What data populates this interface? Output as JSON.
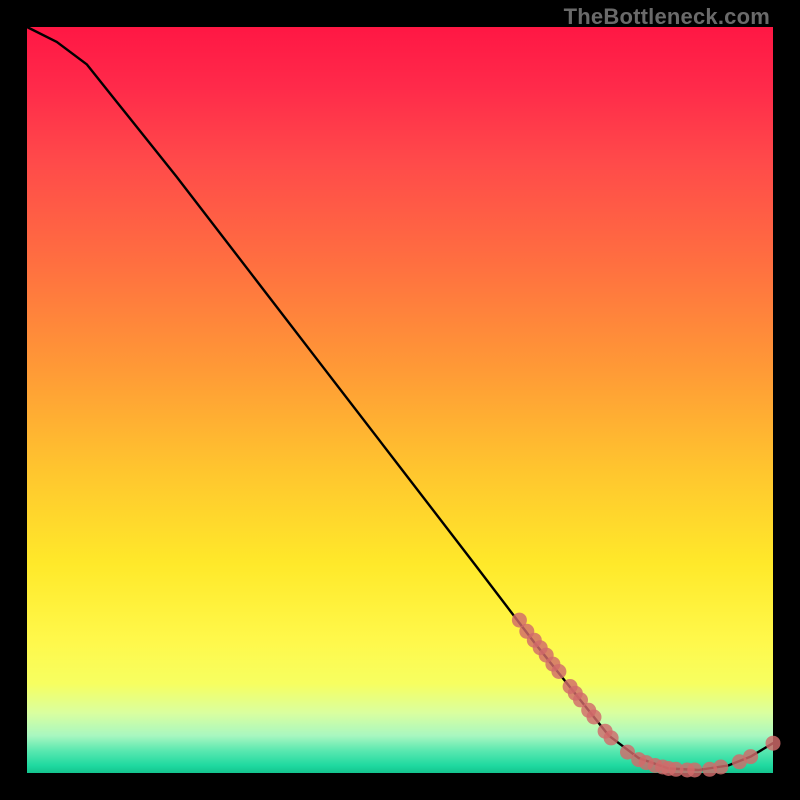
{
  "watermark": "TheBottleneck.com",
  "chart_data": {
    "type": "line",
    "title": "",
    "xlabel": "",
    "ylabel": "",
    "xlim": [
      0,
      100
    ],
    "ylim": [
      0,
      100
    ],
    "curve": [
      {
        "x": 0,
        "y": 100
      },
      {
        "x": 4,
        "y": 98
      },
      {
        "x": 8,
        "y": 95
      },
      {
        "x": 12,
        "y": 90
      },
      {
        "x": 20,
        "y": 80
      },
      {
        "x": 30,
        "y": 67
      },
      {
        "x": 40,
        "y": 54
      },
      {
        "x": 50,
        "y": 41
      },
      {
        "x": 60,
        "y": 28
      },
      {
        "x": 68,
        "y": 17.5
      },
      {
        "x": 74,
        "y": 10
      },
      {
        "x": 78,
        "y": 5
      },
      {
        "x": 82,
        "y": 2
      },
      {
        "x": 86,
        "y": 0.6
      },
      {
        "x": 90,
        "y": 0.4
      },
      {
        "x": 94,
        "y": 1
      },
      {
        "x": 97,
        "y": 2.2
      },
      {
        "x": 100,
        "y": 4
      }
    ],
    "points": [
      {
        "x": 66,
        "y": 20.5
      },
      {
        "x": 67,
        "y": 19
      },
      {
        "x": 68,
        "y": 17.8
      },
      {
        "x": 68.8,
        "y": 16.8
      },
      {
        "x": 69.6,
        "y": 15.8
      },
      {
        "x": 70.5,
        "y": 14.6
      },
      {
        "x": 71.3,
        "y": 13.6
      },
      {
        "x": 72.8,
        "y": 11.6
      },
      {
        "x": 73.5,
        "y": 10.7
      },
      {
        "x": 74.2,
        "y": 9.8
      },
      {
        "x": 75.3,
        "y": 8.4
      },
      {
        "x": 76,
        "y": 7.5
      },
      {
        "x": 77.5,
        "y": 5.6
      },
      {
        "x": 78.3,
        "y": 4.7
      },
      {
        "x": 80.5,
        "y": 2.8
      },
      {
        "x": 82,
        "y": 1.8
      },
      {
        "x": 83,
        "y": 1.4
      },
      {
        "x": 84.2,
        "y": 1.0
      },
      {
        "x": 85.2,
        "y": 0.8
      },
      {
        "x": 86,
        "y": 0.6
      },
      {
        "x": 87,
        "y": 0.5
      },
      {
        "x": 88.5,
        "y": 0.4
      },
      {
        "x": 89.5,
        "y": 0.4
      },
      {
        "x": 91.5,
        "y": 0.5
      },
      {
        "x": 93,
        "y": 0.8
      },
      {
        "x": 95.5,
        "y": 1.5
      },
      {
        "x": 97,
        "y": 2.2
      },
      {
        "x": 100,
        "y": 4.0
      }
    ],
    "colors": {
      "curve": "#000000",
      "dot": "#d16a6a",
      "gradient_top": "#ff1744",
      "gradient_mid": "#ffe92a",
      "gradient_bottom": "#14c48e"
    }
  }
}
